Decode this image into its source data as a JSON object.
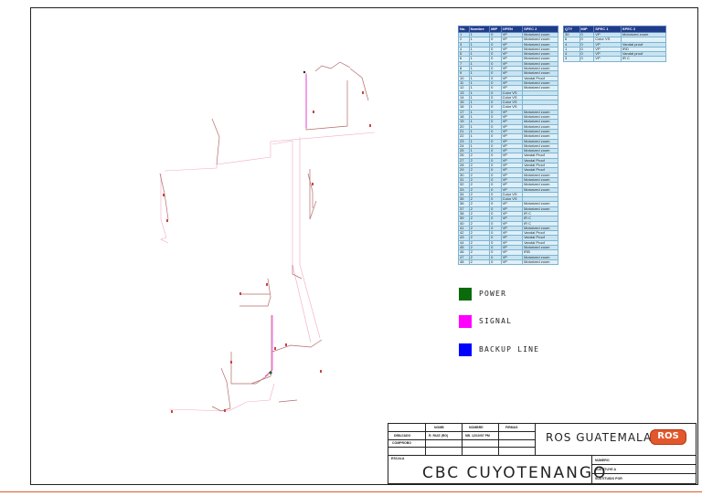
{
  "cable_table": {
    "headers": [
      "No.",
      "Nombre",
      "MIP",
      "OPEN",
      "SPEC 2"
    ],
    "rows": [
      [
        "1",
        "1",
        "0",
        "VP",
        "Motorized zoom"
      ],
      [
        "2",
        "1",
        "0",
        "VP",
        "Motorized zoom"
      ],
      [
        "3",
        "1",
        "0",
        "VP",
        "Motorized zoom"
      ],
      [
        "4",
        "1",
        "0",
        "VP",
        "Motorized zoom"
      ],
      [
        "5",
        "1",
        "0",
        "VP",
        "Motorized zoom"
      ],
      [
        "6",
        "1",
        "0",
        "VP",
        "Motorized zoom"
      ],
      [
        "7",
        "1",
        "0",
        "VP",
        "Motorized zoom"
      ],
      [
        "8",
        "1",
        "0",
        "VP",
        "Motorized zoom"
      ],
      [
        "9",
        "1",
        "0",
        "VP",
        "Motorized zoom"
      ],
      [
        "10",
        "1",
        "0",
        "VP",
        "Vandal Proof"
      ],
      [
        "11",
        "1",
        "0",
        "VP",
        "Motorized zoom"
      ],
      [
        "12",
        "1",
        "0",
        "VP",
        "Motorized zoom"
      ],
      [
        "13",
        "1",
        "0",
        "Color VS",
        ""
      ],
      [
        "14",
        "1",
        "0",
        "Color VS",
        ""
      ],
      [
        "15",
        "1",
        "0",
        "Color VS",
        ""
      ],
      [
        "16",
        "1",
        "0",
        "Color VS",
        ""
      ],
      [
        "17",
        "1",
        "0",
        "VP",
        "Motorized zoom"
      ],
      [
        "18",
        "1",
        "0",
        "VP",
        "Motorized zoom"
      ],
      [
        "19",
        "1",
        "0",
        "VP",
        "Motorized zoom"
      ],
      [
        "20",
        "1",
        "0",
        "VP",
        "Motorized zoom"
      ],
      [
        "21",
        "1",
        "0",
        "VP",
        "Motorized zoom"
      ],
      [
        "22",
        "1",
        "0",
        "VP",
        "Motorized zoom"
      ],
      [
        "23",
        "1",
        "0",
        "VP",
        "Motorized zoom"
      ],
      [
        "24",
        "1",
        "0",
        "VP",
        "Motorized zoom"
      ],
      [
        "25",
        "1",
        "0",
        "VP",
        "Motorized zoom"
      ],
      [
        "26",
        "2",
        "0",
        "VP",
        "Vandal Proof"
      ],
      [
        "27",
        "2",
        "0",
        "VP",
        "Vandal Proof"
      ],
      [
        "28",
        "2",
        "0",
        "VP",
        "Vandal Proof"
      ],
      [
        "29",
        "2",
        "0",
        "VP",
        "Vandal Proof"
      ],
      [
        "30",
        "2",
        "0",
        "VP",
        "Motorized zoom"
      ],
      [
        "31",
        "2",
        "0",
        "VP",
        "Motorized zoom"
      ],
      [
        "32",
        "2",
        "0",
        "VP",
        "Motorized zoom"
      ],
      [
        "33",
        "2",
        "0",
        "VP",
        "Motorized zoom"
      ],
      [
        "34",
        "2",
        "0",
        "Color VS",
        ""
      ],
      [
        "35",
        "2",
        "0",
        "Color VS",
        ""
      ],
      [
        "36",
        "2",
        "0",
        "VP",
        "Motorized zoom"
      ],
      [
        "37",
        "2",
        "0",
        "VP",
        "Motorized zoom"
      ],
      [
        "38",
        "2",
        "0",
        "VP",
        "IR C"
      ],
      [
        "39",
        "2",
        "0",
        "VP",
        "IR C"
      ],
      [
        "40",
        "2",
        "0",
        "VP",
        "IR C"
      ],
      [
        "41",
        "2",
        "0",
        "VP",
        "Motorized zoom"
      ],
      [
        "42",
        "2",
        "0",
        "VP",
        "Vandal Proof"
      ],
      [
        "43",
        "2",
        "0",
        "VP",
        "Vandal Proof"
      ],
      [
        "44",
        "2",
        "0",
        "VP",
        "Vandal Proof"
      ],
      [
        "45",
        "2",
        "0",
        "VP",
        "Motorized zoom"
      ],
      [
        "46",
        "2",
        "0",
        "VP",
        "IRB"
      ],
      [
        "47",
        "2",
        "0",
        "VP",
        "Motorized zoom"
      ],
      [
        "48",
        "2",
        "0",
        "VP",
        "Motorized zoom"
      ]
    ]
  },
  "summary_table": {
    "headers": [
      "QTY",
      "MIP",
      "SPEC 1",
      "SPEC 2"
    ],
    "rows": [
      [
        "30",
        "0",
        "VP",
        "Motorized zoom"
      ],
      [
        "6",
        "0",
        "Color VS",
        ""
      ],
      [
        "4",
        "0",
        "VP",
        "Vandal proof"
      ],
      [
        "1",
        "0",
        "VP",
        "IRD"
      ],
      [
        "4",
        "0",
        "VP",
        "Vandal proof"
      ],
      [
        "3",
        "0",
        "VP",
        "IR C"
      ]
    ]
  },
  "legend": [
    {
      "label": "POWER",
      "color": "#0a6b0a"
    },
    {
      "label": "SIGNAL",
      "color": "#ff00ff"
    },
    {
      "label": "BACKUP LINE",
      "color": "#0000ff"
    }
  ],
  "title_block": {
    "row1": [
      "NOMB",
      "NOMBRE",
      "FIRMAS"
    ],
    "row2_label": "DIBUJADO",
    "row2_values": [
      "R. RUIZ (RG)",
      "NB. 12/10/07 PM"
    ],
    "row3_label": "COMPROBO",
    "row4_label": "ESCALA",
    "company": "ROS GUATEMALA",
    "logo": "ROS",
    "project": "CBC CUYOTENANGO",
    "info": [
      "NUMERO",
      "SUSTITUYE A",
      "SUSTITUIDO POR"
    ]
  },
  "colors": {
    "table_header": "#1f3c88",
    "table_row": "#c7e4f2",
    "signal_line": "#ff00ff",
    "wall_line": "#b56b6b",
    "accent": "#e2572c"
  }
}
